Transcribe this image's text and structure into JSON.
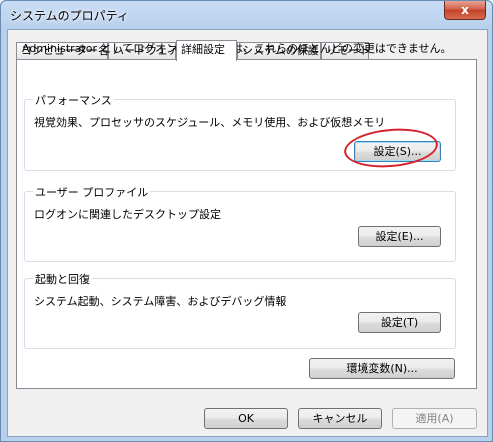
{
  "window": {
    "title": "システムのプロパティ",
    "close_glyph": "x"
  },
  "tabs": [
    {
      "label": "コンピューター名",
      "active": false
    },
    {
      "label": "ハードウェア",
      "active": false
    },
    {
      "label": "詳細設定",
      "active": true
    },
    {
      "label": "システムの保護",
      "active": false
    },
    {
      "label": "リモート",
      "active": false
    }
  ],
  "admin_note": "Administrator としてログオンしない場合は、これらのほとんどの変更はできません。",
  "performance": {
    "title": "パフォーマンス",
    "description": "視覚効果、プロセッサのスケジュール、メモリ使用、および仮想メモリ",
    "button": "設定(S)..."
  },
  "user_profiles": {
    "title": "ユーザー プロファイル",
    "description": "ログオンに関連したデスクトップ設定",
    "button": "設定(E)..."
  },
  "startup_recovery": {
    "title": "起動と回復",
    "description": "システム起動、システム障害、およびデバッグ情報",
    "button": "設定(T)"
  },
  "env_button": "環境変数(N)...",
  "footer": {
    "ok": "OK",
    "cancel": "キャンセル",
    "apply": "適用(A)"
  },
  "colors": {
    "annotation_circle": "#d6222d",
    "title_bar": "#b9d0ec",
    "close_button": "#c3422b"
  }
}
